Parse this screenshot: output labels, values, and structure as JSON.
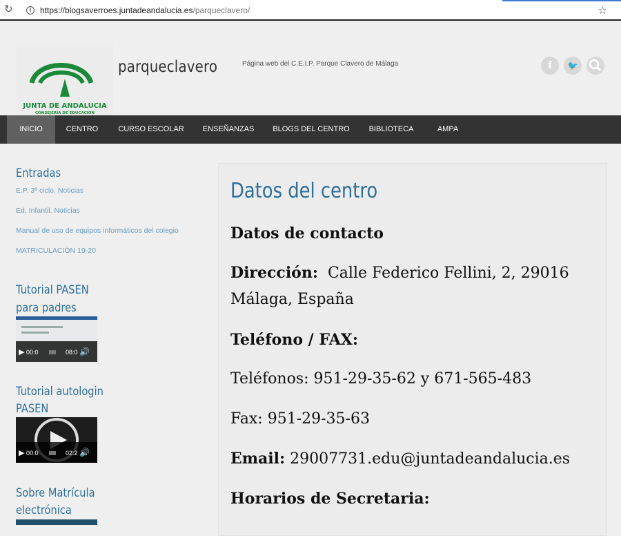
{
  "browser": {
    "url_host": "https://blogsaverroes.juntadeandalucia.es",
    "url_path": "/parqueclavero/"
  },
  "header": {
    "logo_text": "JUNTA DE ANDALUCIA",
    "logo_subtext": "CONSEJERÍA DE EDUCACIÓN",
    "site_title": "parqueclavero",
    "tagline": "Página web del C.E.I.P. Parque Clavero de Málaga",
    "social": [
      "facebook-icon",
      "twitter-icon",
      "search-icon"
    ]
  },
  "nav": {
    "items": [
      "INICIO",
      "CENTRO",
      "CURSO ESCOLAR",
      "ENSEÑANZAS",
      "BLOGS DEL CENTRO",
      "BIBLIOTECA",
      "AMPA"
    ],
    "active": "INICIO"
  },
  "sidebar": {
    "entradas_title": "Entradas",
    "posts": [
      "E.P. 3º ciclo. Noticias",
      "Ed. Infantil. Noticias",
      "Manual de uso de equipos informáticos del colegio",
      "MATRICULACIÓN 19-20"
    ],
    "pasen_title_1": "Tutorial PASEN",
    "pasen_title_2": "para padres",
    "pasen_video_time1": "00:0",
    "pasen_video_time2": "08:0",
    "autologin_title_1": "Tutorial autologin",
    "autologin_title_2": "PASEN",
    "autologin_video_time1": "00:0",
    "autologin_video_time2": "02:2",
    "matricula_title_1": "Sobre Matrícula",
    "matricula_title_2": "electrónica"
  },
  "main": {
    "title": "Datos del centro",
    "contact_heading": "Datos de contacto",
    "address_label": "Dirección:",
    "address_value": "Calle Federico Fellini, 2, 29016",
    "address_value_2": "Málaga, España",
    "phone_heading": "Teléfono / FAX:",
    "phones": "Teléfonos: 951-29-35-62 y 671-565-483",
    "fax": "Fax: 951-29-35-63",
    "email_label": "Email:",
    "email_value": "29007731.edu@juntadeandalucia.es",
    "hours_heading": "Horarios de Secretaria:"
  },
  "colors": {
    "accent": "#2e6f9e",
    "nav_bg": "#333333",
    "nav_active": "#606060",
    "logo_green": "#1a8a3a"
  }
}
